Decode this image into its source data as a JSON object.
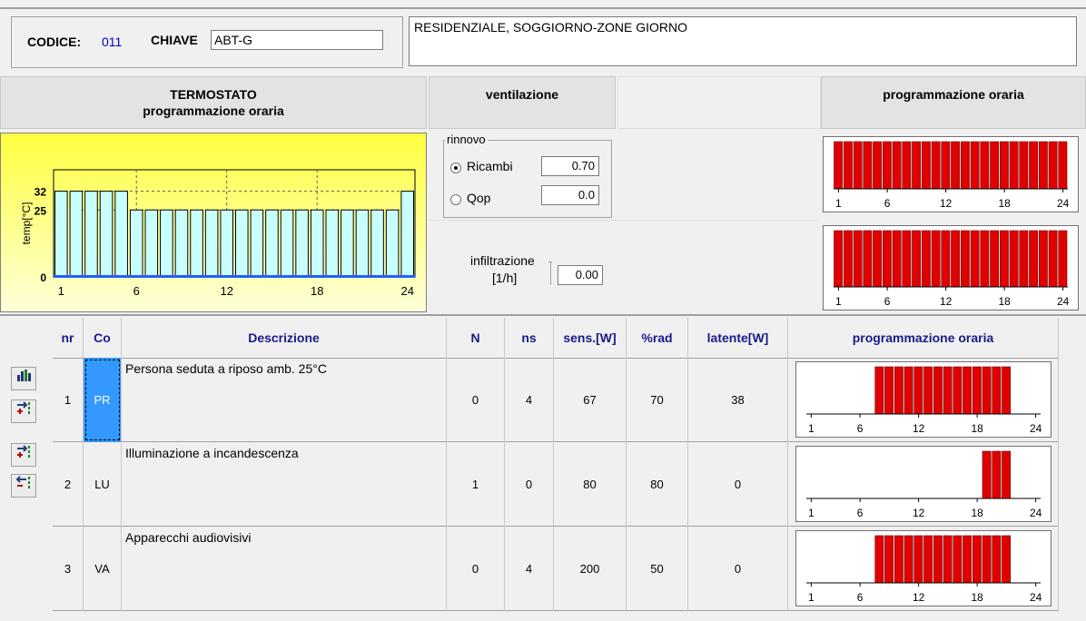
{
  "header": {
    "codice_label": "CODICE:",
    "codice_value": "011",
    "chiave_label": "CHIAVE",
    "chiave_value": "ABT-G",
    "description": "RESIDENZIALE, SOGGIORNO-ZONE GIORNO"
  },
  "sections": {
    "thermo_title": "TERMOSTATO",
    "thermo_subtitle": "programmazione oraria",
    "ventilation_title": "ventilazione",
    "schedule_title": "programmazione oraria"
  },
  "ventilation": {
    "group_label": "rinnovo",
    "ricambi_label": "Ricambi",
    "ricambi_value": "0.70",
    "qop_label": "Qop",
    "qop_value": "0.0",
    "selected": "Ricambi",
    "infiltration_label": "infiltrazione",
    "infiltration_unit": "[1/h]",
    "infiltration_value": "0.00"
  },
  "schedule_axis": [
    "1",
    "6",
    "12",
    "18",
    "24"
  ],
  "colors": {
    "bar_red": "#e00000",
    "chart_bar": "#c8ffff",
    "accent_blue": "#3399ff",
    "header_text": "#1a1a8a"
  },
  "chart_data": {
    "type": "bar",
    "ylabel": "temp[°C]",
    "yticks": [
      "0",
      "25",
      "32"
    ],
    "xticks": [
      "1",
      "6",
      "12",
      "18",
      "24"
    ],
    "categories": [
      1,
      2,
      3,
      4,
      5,
      6,
      7,
      8,
      9,
      10,
      11,
      12,
      13,
      14,
      15,
      16,
      17,
      18,
      19,
      20,
      21,
      22,
      23,
      24
    ],
    "values": [
      32,
      32,
      32,
      32,
      32,
      25,
      25,
      25,
      25,
      25,
      25,
      25,
      25,
      25,
      25,
      25,
      25,
      25,
      25,
      25,
      25,
      25,
      25,
      32
    ],
    "ylim": [
      0,
      40
    ],
    "grid": true
  },
  "schedules": {
    "ventilation_on": [
      1,
      1,
      1,
      1,
      1,
      1,
      1,
      1,
      1,
      1,
      1,
      1,
      1,
      1,
      1,
      1,
      1,
      1,
      1,
      1,
      1,
      1,
      1,
      1
    ],
    "infiltration_on": [
      1,
      1,
      1,
      1,
      1,
      1,
      1,
      1,
      1,
      1,
      1,
      1,
      1,
      1,
      1,
      1,
      1,
      1,
      1,
      1,
      1,
      1,
      1,
      1
    ]
  },
  "table": {
    "headers": {
      "nr": "nr",
      "co": "Co",
      "desc": "Descrizione",
      "n": "N",
      "ns": "ns",
      "sens": "sens.[W]",
      "rad": "%rad",
      "lat": "latente[W]",
      "sched": "programmazione oraria"
    },
    "rows": [
      {
        "nr": "1",
        "co": "PR",
        "desc": "Persona seduta a riposo amb. 25°C",
        "n": "0",
        "ns": "4",
        "sens": "67",
        "rad": "70",
        "lat": "38",
        "hours": [
          0,
          0,
          0,
          0,
          0,
          0,
          0,
          1,
          1,
          1,
          1,
          1,
          1,
          1,
          1,
          1,
          1,
          1,
          1,
          1,
          1,
          0,
          0,
          0
        ]
      },
      {
        "nr": "2",
        "co": "LU",
        "desc": "Illuminazione a incandescenza",
        "n": "1",
        "ns": "0",
        "sens": "80",
        "rad": "80",
        "lat": "0",
        "hours": [
          0,
          0,
          0,
          0,
          0,
          0,
          0,
          0,
          0,
          0,
          0,
          0,
          0,
          0,
          0,
          0,
          0,
          0,
          1,
          1,
          1,
          0,
          0,
          0
        ]
      },
      {
        "nr": "3",
        "co": "VA",
        "desc": "Apparecchi audiovisivi",
        "n": "0",
        "ns": "4",
        "sens": "200",
        "rad": "50",
        "lat": "0",
        "hours": [
          0,
          0,
          0,
          0,
          0,
          0,
          0,
          1,
          1,
          1,
          1,
          1,
          1,
          1,
          1,
          1,
          1,
          1,
          1,
          1,
          1,
          0,
          0,
          0
        ]
      }
    ]
  },
  "toolbar": [
    "chart-icon",
    "insert-row-icon",
    "add-row-icon",
    "delete-row-icon"
  ]
}
